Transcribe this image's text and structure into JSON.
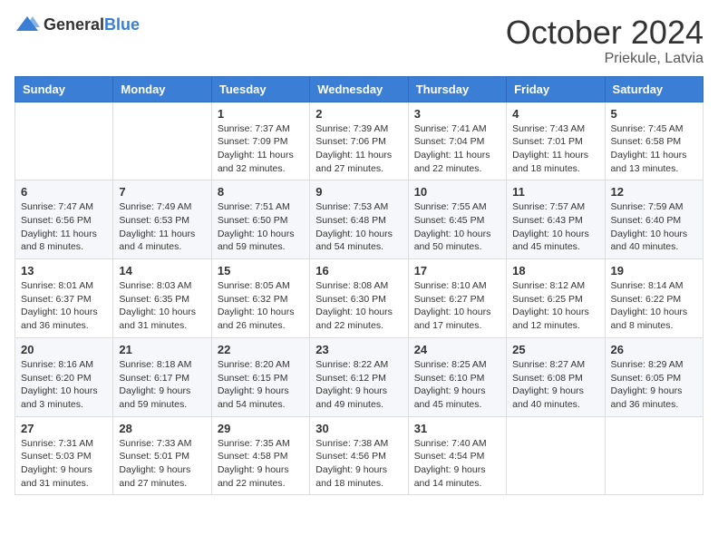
{
  "header": {
    "logo_general": "General",
    "logo_blue": "Blue",
    "title": "October 2024",
    "location": "Priekule, Latvia"
  },
  "days_of_week": [
    "Sunday",
    "Monday",
    "Tuesday",
    "Wednesday",
    "Thursday",
    "Friday",
    "Saturday"
  ],
  "weeks": [
    [
      {
        "day": "",
        "info": ""
      },
      {
        "day": "",
        "info": ""
      },
      {
        "day": "1",
        "info": "Sunrise: 7:37 AM\nSunset: 7:09 PM\nDaylight: 11 hours and 32 minutes."
      },
      {
        "day": "2",
        "info": "Sunrise: 7:39 AM\nSunset: 7:06 PM\nDaylight: 11 hours and 27 minutes."
      },
      {
        "day": "3",
        "info": "Sunrise: 7:41 AM\nSunset: 7:04 PM\nDaylight: 11 hours and 22 minutes."
      },
      {
        "day": "4",
        "info": "Sunrise: 7:43 AM\nSunset: 7:01 PM\nDaylight: 11 hours and 18 minutes."
      },
      {
        "day": "5",
        "info": "Sunrise: 7:45 AM\nSunset: 6:58 PM\nDaylight: 11 hours and 13 minutes."
      }
    ],
    [
      {
        "day": "6",
        "info": "Sunrise: 7:47 AM\nSunset: 6:56 PM\nDaylight: 11 hours and 8 minutes."
      },
      {
        "day": "7",
        "info": "Sunrise: 7:49 AM\nSunset: 6:53 PM\nDaylight: 11 hours and 4 minutes."
      },
      {
        "day": "8",
        "info": "Sunrise: 7:51 AM\nSunset: 6:50 PM\nDaylight: 10 hours and 59 minutes."
      },
      {
        "day": "9",
        "info": "Sunrise: 7:53 AM\nSunset: 6:48 PM\nDaylight: 10 hours and 54 minutes."
      },
      {
        "day": "10",
        "info": "Sunrise: 7:55 AM\nSunset: 6:45 PM\nDaylight: 10 hours and 50 minutes."
      },
      {
        "day": "11",
        "info": "Sunrise: 7:57 AM\nSunset: 6:43 PM\nDaylight: 10 hours and 45 minutes."
      },
      {
        "day": "12",
        "info": "Sunrise: 7:59 AM\nSunset: 6:40 PM\nDaylight: 10 hours and 40 minutes."
      }
    ],
    [
      {
        "day": "13",
        "info": "Sunrise: 8:01 AM\nSunset: 6:37 PM\nDaylight: 10 hours and 36 minutes."
      },
      {
        "day": "14",
        "info": "Sunrise: 8:03 AM\nSunset: 6:35 PM\nDaylight: 10 hours and 31 minutes."
      },
      {
        "day": "15",
        "info": "Sunrise: 8:05 AM\nSunset: 6:32 PM\nDaylight: 10 hours and 26 minutes."
      },
      {
        "day": "16",
        "info": "Sunrise: 8:08 AM\nSunset: 6:30 PM\nDaylight: 10 hours and 22 minutes."
      },
      {
        "day": "17",
        "info": "Sunrise: 8:10 AM\nSunset: 6:27 PM\nDaylight: 10 hours and 17 minutes."
      },
      {
        "day": "18",
        "info": "Sunrise: 8:12 AM\nSunset: 6:25 PM\nDaylight: 10 hours and 12 minutes."
      },
      {
        "day": "19",
        "info": "Sunrise: 8:14 AM\nSunset: 6:22 PM\nDaylight: 10 hours and 8 minutes."
      }
    ],
    [
      {
        "day": "20",
        "info": "Sunrise: 8:16 AM\nSunset: 6:20 PM\nDaylight: 10 hours and 3 minutes."
      },
      {
        "day": "21",
        "info": "Sunrise: 8:18 AM\nSunset: 6:17 PM\nDaylight: 9 hours and 59 minutes."
      },
      {
        "day": "22",
        "info": "Sunrise: 8:20 AM\nSunset: 6:15 PM\nDaylight: 9 hours and 54 minutes."
      },
      {
        "day": "23",
        "info": "Sunrise: 8:22 AM\nSunset: 6:12 PM\nDaylight: 9 hours and 49 minutes."
      },
      {
        "day": "24",
        "info": "Sunrise: 8:25 AM\nSunset: 6:10 PM\nDaylight: 9 hours and 45 minutes."
      },
      {
        "day": "25",
        "info": "Sunrise: 8:27 AM\nSunset: 6:08 PM\nDaylight: 9 hours and 40 minutes."
      },
      {
        "day": "26",
        "info": "Sunrise: 8:29 AM\nSunset: 6:05 PM\nDaylight: 9 hours and 36 minutes."
      }
    ],
    [
      {
        "day": "27",
        "info": "Sunrise: 7:31 AM\nSunset: 5:03 PM\nDaylight: 9 hours and 31 minutes."
      },
      {
        "day": "28",
        "info": "Sunrise: 7:33 AM\nSunset: 5:01 PM\nDaylight: 9 hours and 27 minutes."
      },
      {
        "day": "29",
        "info": "Sunrise: 7:35 AM\nSunset: 4:58 PM\nDaylight: 9 hours and 22 minutes."
      },
      {
        "day": "30",
        "info": "Sunrise: 7:38 AM\nSunset: 4:56 PM\nDaylight: 9 hours and 18 minutes."
      },
      {
        "day": "31",
        "info": "Sunrise: 7:40 AM\nSunset: 4:54 PM\nDaylight: 9 hours and 14 minutes."
      },
      {
        "day": "",
        "info": ""
      },
      {
        "day": "",
        "info": ""
      }
    ]
  ]
}
